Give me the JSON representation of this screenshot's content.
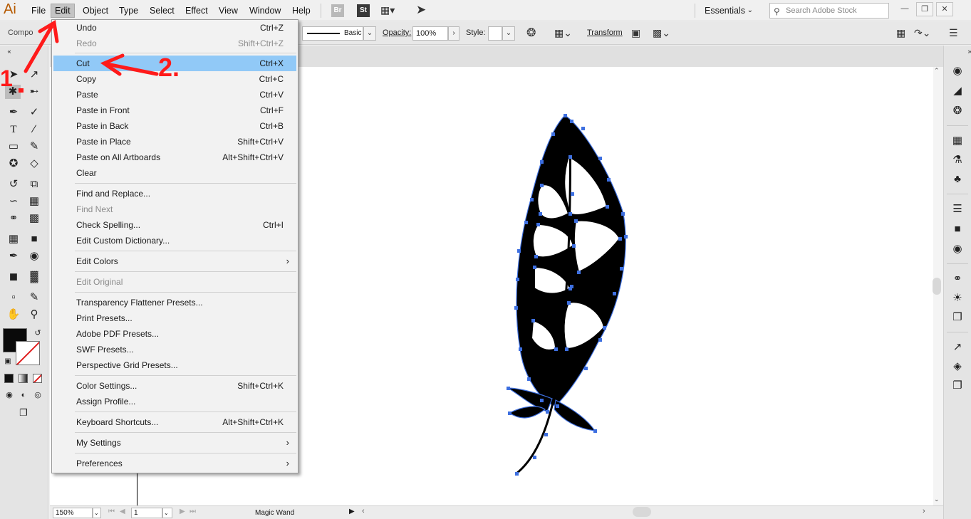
{
  "app": {
    "logo": "Ai"
  },
  "menubar": {
    "items": [
      "File",
      "Edit",
      "Object",
      "Type",
      "Select",
      "Effect",
      "View",
      "Window",
      "Help"
    ],
    "bridge_tile": "Br",
    "stock_tile": "St",
    "workspace": "Essentials",
    "search_placeholder": "Search Adobe Stock"
  },
  "controlbar": {
    "selection_type": "Compo",
    "stroke_profile": "Basic",
    "opacity_label": "Opacity:",
    "opacity_value": "100%",
    "style_label": "Style:",
    "transform_label": "Transform"
  },
  "edit_menu": {
    "items": [
      {
        "label": "Undo",
        "shortcut": "Ctrl+Z",
        "disabled": false
      },
      {
        "label": "Redo",
        "shortcut": "Shift+Ctrl+Z",
        "disabled": true
      },
      {
        "label": "Cut",
        "shortcut": "Ctrl+X",
        "highlighted": true
      },
      {
        "label": "Copy",
        "shortcut": "Ctrl+C"
      },
      {
        "label": "Paste",
        "shortcut": "Ctrl+V"
      },
      {
        "label": "Paste in Front",
        "shortcut": "Ctrl+F"
      },
      {
        "label": "Paste in Back",
        "shortcut": "Ctrl+B"
      },
      {
        "label": "Paste in Place",
        "shortcut": "Shift+Ctrl+V"
      },
      {
        "label": "Paste on All Artboards",
        "shortcut": "Alt+Shift+Ctrl+V"
      },
      {
        "label": "Clear",
        "shortcut": ""
      },
      {
        "label": "Find and Replace...",
        "shortcut": ""
      },
      {
        "label": "Find Next",
        "shortcut": "",
        "disabled": true
      },
      {
        "label": "Check Spelling...",
        "shortcut": "Ctrl+I"
      },
      {
        "label": "Edit Custom Dictionary...",
        "shortcut": ""
      },
      {
        "label": "Edit Colors",
        "shortcut": "",
        "submenu": true
      },
      {
        "label": "Edit Original",
        "shortcut": "",
        "disabled": true
      },
      {
        "label": "Transparency Flattener Presets...",
        "shortcut": ""
      },
      {
        "label": "Print Presets...",
        "shortcut": ""
      },
      {
        "label": "Adobe PDF Presets...",
        "shortcut": ""
      },
      {
        "label": "SWF Presets...",
        "shortcut": ""
      },
      {
        "label": "Perspective Grid Presets...",
        "shortcut": ""
      },
      {
        "label": "Color Settings...",
        "shortcut": "Shift+Ctrl+K"
      },
      {
        "label": "Assign Profile...",
        "shortcut": ""
      },
      {
        "label": "Keyboard Shortcuts...",
        "shortcut": "Alt+Shift+Ctrl+K"
      },
      {
        "label": "My Settings",
        "shortcut": "",
        "submenu": true
      },
      {
        "label": "Preferences",
        "shortcut": "",
        "submenu": true
      }
    ]
  },
  "statusbar": {
    "zoom": "150%",
    "artboard": "1",
    "tool": "Magic Wand"
  },
  "annotations": {
    "step1": "1",
    "step2": "2."
  },
  "colors": {
    "highlight": "#91c9f7",
    "annotation": "#ff1a1a",
    "anchor": "#3d6fe0"
  }
}
